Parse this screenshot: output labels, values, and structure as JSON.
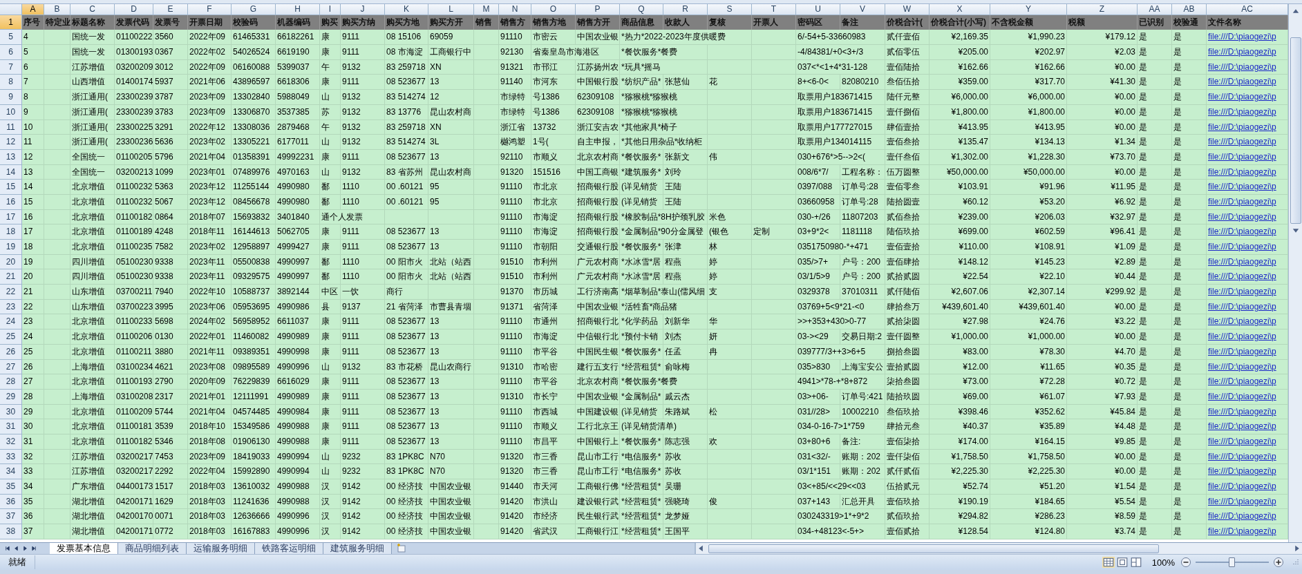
{
  "sheet": {
    "columns": [
      {
        "letter": "A",
        "heading": "序号",
        "selected": true
      },
      {
        "letter": "B",
        "heading": "特定业",
        "selected": false
      },
      {
        "letter": "C",
        "heading": "标题名称",
        "selected": false
      },
      {
        "letter": "D",
        "heading": "发票代码",
        "selected": false
      },
      {
        "letter": "E",
        "heading": "发票号",
        "selected": false
      },
      {
        "letter": "F",
        "heading": "开票日期",
        "selected": false
      },
      {
        "letter": "G",
        "heading": "校验码",
        "selected": false
      },
      {
        "letter": "H",
        "heading": "机器编码",
        "selected": false
      },
      {
        "letter": "I",
        "heading": "购买",
        "selected": false
      },
      {
        "letter": "J",
        "heading": "购买方纳",
        "selected": false
      },
      {
        "letter": "K",
        "heading": "购买方地",
        "selected": false
      },
      {
        "letter": "L",
        "heading": "购买方开",
        "selected": false
      },
      {
        "letter": "M",
        "heading": "销售",
        "selected": false
      },
      {
        "letter": "N",
        "heading": "销售方",
        "selected": false
      },
      {
        "letter": "O",
        "heading": "销售方地",
        "selected": false
      },
      {
        "letter": "P",
        "heading": "销售方开",
        "selected": false
      },
      {
        "letter": "Q",
        "heading": "商品信息",
        "selected": false
      },
      {
        "letter": "R",
        "heading": "收款人",
        "selected": false
      },
      {
        "letter": "S",
        "heading": "复核",
        "selected": false
      },
      {
        "letter": "T",
        "heading": "开票人",
        "selected": false
      },
      {
        "letter": "U",
        "heading": "密码区",
        "selected": false
      },
      {
        "letter": "V",
        "heading": "备注",
        "selected": false
      },
      {
        "letter": "W",
        "heading": "价税合计(",
        "selected": false
      },
      {
        "letter": "X",
        "heading": "价税合计(小写)",
        "selected": false,
        "kind": "currency"
      },
      {
        "letter": "Y",
        "heading": "不含税金额",
        "selected": false,
        "kind": "currency"
      },
      {
        "letter": "Z",
        "heading": "税额",
        "selected": false,
        "kind": "currency"
      },
      {
        "letter": "AA",
        "heading": "已识别",
        "selected": false
      },
      {
        "letter": "AB",
        "heading": "校验通",
        "selected": false
      },
      {
        "letter": "AC",
        "heading": "文件名称",
        "selected": false,
        "kind": "link"
      }
    ],
    "header_row": {
      "number": "1",
      "selected": true
    },
    "rows": [
      {
        "number": "5",
        "selected": false,
        "cells": {
          "A": "4",
          "C": "国统一发",
          "D": "01100222",
          "E": "3560",
          "F": "2022年09",
          "G": "61465331",
          "H": "66182261",
          "I": "康",
          "J": "9111",
          "K": "08 15106",
          "L": "69059",
          "N": "91110",
          "O": "市密云",
          "P": "中国农业银",
          "Q": "*热力*2022-2023年度供暖费",
          "U": "6/-54+5-33660983",
          "W": "贰仟壹佰",
          "X": "¥2,169.35",
          "Y": "¥1,990.23",
          "Z": "¥179.12",
          "AA": "是",
          "AB": "是",
          "AC": "file:///D:\\piaogezi\\p"
        }
      },
      {
        "number": "6",
        "selected": false,
        "cells": {
          "A": "5",
          "C": "国统一发",
          "D": "01300193",
          "E": "0367",
          "F": "2022年02",
          "G": "54026524",
          "H": "6619190",
          "I": "康",
          "J": "9111",
          "K": "08 市海淀",
          "L": "工商银行中",
          "N": "92130",
          "O": "省秦皇岛市海港区",
          "Q": "*餐饮服务*餐费",
          "U": "-4/84381/+0<3+/3",
          "W": "贰佰零伍",
          "X": "¥205.00",
          "Y": "¥202.97",
          "Z": "¥2.03",
          "AA": "是",
          "AB": "是",
          "AC": "file:///D:\\piaogezi\\p"
        }
      },
      {
        "number": "7",
        "selected": false,
        "cells": {
          "A": "6",
          "C": "江苏增值",
          "D": "03200209",
          "E": "3012",
          "F": "2022年09",
          "G": "06160088",
          "H": "5399037",
          "I": "午",
          "J": "9132",
          "K": "83 259718",
          "L": "XN",
          "N": "91321",
          "O": "市邗江",
          "P": "江苏扬州农",
          "Q": "*玩具*摇马",
          "U": "037<*<1+4*31-128",
          "W": "壹佰陆拾",
          "X": "¥162.66",
          "Y": "¥162.66",
          "Z": "¥0.00",
          "AA": "是",
          "AB": "是",
          "AC": "file:///D:\\piaogezi\\p"
        }
      },
      {
        "number": "8",
        "selected": false,
        "cells": {
          "A": "7",
          "C": "山西增值",
          "D": "01400174",
          "E": "5937",
          "F": "2021年06",
          "G": "43896597",
          "H": "6618306",
          "I": "康",
          "J": "9111",
          "K": "08 523677",
          "L": "13",
          "N": "91140",
          "O": "市河东",
          "P": "中国银行股",
          "Q": "*纺织产品*",
          "R": "张慧仙",
          "S": "花",
          "U": "8+<6-0<",
          "V": "82080210",
          "W": "叁佰伍拾",
          "X": "¥359.00",
          "Y": "¥317.70",
          "Z": "¥41.30",
          "AA": "是",
          "AB": "是",
          "AC": "file:///D:\\piaogezi\\p"
        }
      },
      {
        "number": "9",
        "selected": false,
        "cells": {
          "A": "8",
          "C": "浙江通用(",
          "D": "23300239",
          "E": "3787",
          "F": "2023年09",
          "G": "13302840",
          "H": "5988049",
          "I": "山",
          "J": "9132",
          "K": "83 514274",
          "L": "12",
          "N": "市绿特",
          "O": "号1386",
          "P": "62309108",
          "Q": "*猕猴桃*猕猴桃",
          "U": "取票用户183671415",
          "W": "陆仟元整",
          "X": "¥6,000.00",
          "Y": "¥6,000.00",
          "Z": "¥0.00",
          "AA": "是",
          "AB": "是",
          "AC": "file:///D:\\piaogezi\\p"
        }
      },
      {
        "number": "10",
        "selected": false,
        "cells": {
          "A": "9",
          "C": "浙江通用(",
          "D": "23300239",
          "E": "3783",
          "F": "2023年09",
          "G": "13306870",
          "H": "3537385",
          "I": "苏",
          "J": "9132",
          "K": "83 13776",
          "L": "昆山农村商",
          "N": "市绿特",
          "O": "号1386",
          "P": "62309108",
          "Q": "*猕猴桃*猕猴桃",
          "U": "取票用户183671415",
          "W": "壹仟捌佰",
          "X": "¥1,800.00",
          "Y": "¥1,800.00",
          "Z": "¥0.00",
          "AA": "是",
          "AB": "是",
          "AC": "file:///D:\\piaogezi\\p"
        }
      },
      {
        "number": "11",
        "selected": false,
        "cells": {
          "A": "10",
          "C": "浙江通用(",
          "D": "23300225",
          "E": "3291",
          "F": "2022年12",
          "G": "13308036",
          "H": "2879468",
          "I": "午",
          "J": "9132",
          "K": "83 259718",
          "L": "XN",
          "N": "浙江省",
          "O": "13732",
          "P": "浙江安吉农",
          "Q": "*其他家具*椅子",
          "U": "取票用户177727015",
          "W": "肆佰壹拾",
          "X": "¥413.95",
          "Y": "¥413.95",
          "Z": "¥0.00",
          "AA": "是",
          "AB": "是",
          "AC": "file:///D:\\piaogezi\\p"
        }
      },
      {
        "number": "12",
        "selected": false,
        "cells": {
          "A": "11",
          "C": "浙江通用(",
          "D": "23300236",
          "E": "5636",
          "F": "2023年02",
          "G": "13305221",
          "H": "6177011",
          "I": "山",
          "J": "9132",
          "K": "83 514274",
          "L": "3L",
          "N": "樾鸿塑",
          "O": "1号(",
          "P": "自主申报，",
          "Q": "*其他日用杂品*收纳柜",
          "U": "取票用户134014115",
          "W": "壹佰叁拾",
          "X": "¥135.47",
          "Y": "¥134.13",
          "Z": "¥1.34",
          "AA": "是",
          "AB": "是",
          "AC": "file:///D:\\piaogezi\\p"
        }
      },
      {
        "number": "13",
        "selected": false,
        "cells": {
          "A": "12",
          "C": "全国统一",
          "D": "01100205",
          "E": "5796",
          "F": "2021年04",
          "G": "01358391",
          "H": "49992231",
          "I": "康",
          "J": "9111",
          "K": "08 523677",
          "L": "13",
          "N": "92110",
          "O": "市顺义",
          "P": "北京农村商",
          "Q": "*餐饮服务*",
          "R": "张新文",
          "S": "伟",
          "U": "030+676*>5-->2<(",
          "W": "壹仟叁佰",
          "X": "¥1,302.00",
          "Y": "¥1,228.30",
          "Z": "¥73.70",
          "AA": "是",
          "AB": "是",
          "AC": "file:///D:\\piaogezi\\p"
        }
      },
      {
        "number": "14",
        "selected": false,
        "cells": {
          "A": "13",
          "C": "全国统一",
          "D": "03200213",
          "E": "1099",
          "F": "2023年01",
          "G": "07489976",
          "H": "4970163",
          "I": "山",
          "J": "9132",
          "K": "83 省苏州",
          "L": "昆山农村商",
          "N": "91320",
          "O": "151516",
          "P": "中国工商银",
          "Q": "*建筑服务*",
          "R": "刘玲",
          "U": "008/6*7/",
          "V": "工程名称：",
          "W": "伍万圆整",
          "X": "¥50,000.00",
          "Y": "¥50,000.00",
          "Z": "¥0.00",
          "AA": "是",
          "AB": "是",
          "AC": "file:///D:\\piaogezi\\p"
        }
      },
      {
        "number": "15",
        "selected": false,
        "cells": {
          "A": "14",
          "C": "北京增值",
          "D": "01100232",
          "E": "5363",
          "F": "2023年12",
          "G": "11255144",
          "H": "4990980",
          "I": "鄱",
          "J": "1110",
          "K": "00 .60121",
          "L": "95",
          "N": "91110",
          "O": "市北京",
          "P": "招商银行股",
          "Q": "(详见销货",
          "R": "王陆",
          "U": "0397/088",
          "V": "订单号:28",
          "W": "壹佰零叁",
          "X": "¥103.91",
          "Y": "¥91.96",
          "Z": "¥11.95",
          "AA": "是",
          "AB": "是",
          "AC": "file:///D:\\piaogezi\\p"
        }
      },
      {
        "number": "16",
        "selected": false,
        "cells": {
          "A": "15",
          "C": "北京增值",
          "D": "01100232",
          "E": "5067",
          "F": "2023年12",
          "G": "08456678",
          "H": "4990980",
          "I": "鄱",
          "J": "1110",
          "K": "00 .60121",
          "L": "95",
          "N": "91110",
          "O": "市北京",
          "P": "招商银行股",
          "Q": "(详见销货",
          "R": "王陆",
          "U": "03660958",
          "V": "订单号:28",
          "W": "陆拾圆壹",
          "X": "¥60.12",
          "Y": "¥53.20",
          "Z": "¥6.92",
          "AA": "是",
          "AB": "是",
          "AC": "file:///D:\\piaogezi\\p"
        }
      },
      {
        "number": "17",
        "selected": false,
        "cells": {
          "A": "16",
          "C": "北京增值",
          "D": "01100182",
          "E": "0864",
          "F": "2018年07",
          "G": "15693832",
          "H": "3401840",
          "I": "通个人发票",
          "N": "91110",
          "O": "市海淀",
          "P": "招商银行股",
          "Q": "*橡胶制品*8H护颈乳胶",
          "S": "米色",
          "U": "030-+/26",
          "V": "11807203",
          "W": "贰佰叁拾",
          "X": "¥239.00",
          "Y": "¥206.03",
          "Z": "¥32.97",
          "AA": "是",
          "AB": "是",
          "AC": "file:///D:\\piaogezi\\p"
        }
      },
      {
        "number": "18",
        "selected": false,
        "cells": {
          "A": "17",
          "C": "北京增值",
          "D": "01100189",
          "E": "4248",
          "F": "2018年11",
          "G": "16144613",
          "H": "5062705",
          "I": "康",
          "J": "9111",
          "K": "08 523677",
          "L": "13",
          "N": "91110",
          "O": "市海淀",
          "P": "招商银行股",
          "Q": "*金属制品*90分金属登",
          "S": "(银色",
          "T": "定制",
          "U": "03+9*2<",
          "V": "1181118",
          "W": "陆佰玖拾",
          "X": "¥699.00",
          "Y": "¥602.59",
          "Z": "¥96.41",
          "AA": "是",
          "AB": "是",
          "AC": "file:///D:\\piaogezi\\p"
        }
      },
      {
        "number": "19",
        "selected": false,
        "cells": {
          "A": "18",
          "C": "北京增值",
          "D": "01100235",
          "E": "7582",
          "F": "2023年02",
          "G": "12958897",
          "H": "4999427",
          "I": "康",
          "J": "9111",
          "K": "08 523677",
          "L": "13",
          "N": "91110",
          "O": "市朝阳",
          "P": "交通银行股",
          "Q": "*餐饮服务*",
          "R": "张津",
          "S": "林",
          "U": "0351750980-*+471",
          "W": "壹佰壹拾",
          "X": "¥110.00",
          "Y": "¥108.91",
          "Z": "¥1.09",
          "AA": "是",
          "AB": "是",
          "AC": "file:///D:\\piaogezi\\p"
        }
      },
      {
        "number": "20",
        "selected": false,
        "cells": {
          "A": "19",
          "C": "四川增值",
          "D": "05100230",
          "E": "9338",
          "F": "2023年11",
          "G": "05500838",
          "H": "4990997",
          "I": "鄱",
          "J": "1110",
          "K": "00 阳市火",
          "L": "北站（站西",
          "N": "91510",
          "O": "市利州",
          "P": "广元农村商",
          "Q": "*水冰雪*居",
          "R": "程燕",
          "S": "婷",
          "U": "035/>7+",
          "V": "户号：200",
          "W": "壹佰肆拾",
          "X": "¥148.12",
          "Y": "¥145.23",
          "Z": "¥2.89",
          "AA": "是",
          "AB": "是",
          "AC": "file:///D:\\piaogezi\\p"
        }
      },
      {
        "number": "21",
        "selected": false,
        "cells": {
          "A": "20",
          "C": "四川增值",
          "D": "05100230",
          "E": "9338",
          "F": "2023年11",
          "G": "09329575",
          "H": "4990997",
          "I": "鄱",
          "J": "1110",
          "K": "00 阳市火",
          "L": "北站（站西",
          "N": "91510",
          "O": "市利州",
          "P": "广元农村商",
          "Q": "*水冰雪*居",
          "R": "程燕",
          "S": "婷",
          "U": "03/1/5>9",
          "V": "户号：200",
          "W": "贰拾贰圆",
          "X": "¥22.54",
          "Y": "¥22.10",
          "Z": "¥0.44",
          "AA": "是",
          "AB": "是",
          "AC": "file:///D:\\piaogezi\\p"
        }
      },
      {
        "number": "22",
        "selected": false,
        "cells": {
          "A": "21",
          "C": "山东增值",
          "D": "03700211",
          "E": "7940",
          "F": "2022年10",
          "G": "10588737",
          "H": "3892144",
          "I": "中区",
          "J": "一饮",
          "K": "商行",
          "N": "91370",
          "O": "市历城",
          "P": "工行济南高",
          "Q": "*烟草制品*泰山(儒风细",
          "S": "支",
          "U": "0329378",
          "V": "37010311",
          "W": "贰仟陆佰",
          "X": "¥2,607.06",
          "Y": "¥2,307.14",
          "Z": "¥299.92",
          "AA": "是",
          "AB": "是",
          "AC": "file:///D:\\piaogezi\\p"
        }
      },
      {
        "number": "23",
        "selected": false,
        "cells": {
          "A": "22",
          "C": "山东增值",
          "D": "03700223",
          "E": "3995",
          "F": "2023年06",
          "G": "05953695",
          "H": "4990986",
          "I": "县",
          "J": "9137",
          "K": "21 省菏泽",
          "L": "市曹县青堌",
          "N": "91371",
          "O": "省菏泽",
          "P": "中国农业银",
          "Q": "*活牲畜*商品猪",
          "U": "03769+5<9*21-<0",
          "W": "肆拾叁万",
          "X": "¥439,601.40",
          "Y": "¥439,601.40",
          "Z": "¥0.00",
          "AA": "是",
          "AB": "是",
          "AC": "file:///D:\\piaogezi\\p"
        }
      },
      {
        "number": "24",
        "selected": false,
        "cells": {
          "A": "23",
          "C": "北京增值",
          "D": "01100233",
          "E": "5698",
          "F": "2024年02",
          "G": "56958952",
          "H": "6611037",
          "I": "康",
          "J": "9111",
          "K": "08 523677",
          "L": "13",
          "N": "91110",
          "O": "市通州",
          "P": "招商银行北",
          "Q": "*化学药品",
          "R": "刘新华",
          "S": "华",
          "U": ">>+353+430>0-77",
          "W": "贰拾柒圆",
          "X": "¥27.98",
          "Y": "¥24.76",
          "Z": "¥3.22",
          "AA": "是",
          "AB": "是",
          "AC": "file:///D:\\piaogezi\\p"
        }
      },
      {
        "number": "25",
        "selected": false,
        "cells": {
          "A": "24",
          "C": "北京增值",
          "D": "01100206",
          "E": "0130",
          "F": "2022年01",
          "G": "11460082",
          "H": "4990989",
          "I": "康",
          "J": "9111",
          "K": "08 523677",
          "L": "13",
          "N": "91110",
          "O": "市海淀",
          "P": "中信银行北",
          "Q": "*预付卡销",
          "R": "刘杰",
          "S": "妍",
          "U": "03-><29",
          "V": "交易日期:2",
          "W": "壹仟圆整",
          "X": "¥1,000.00",
          "Y": "¥1,000.00",
          "Z": "¥0.00",
          "AA": "是",
          "AB": "是",
          "AC": "file:///D:\\piaogezi\\p"
        }
      },
      {
        "number": "26",
        "selected": false,
        "cells": {
          "A": "25",
          "C": "北京增值",
          "D": "01100211",
          "E": "3880",
          "F": "2021年11",
          "G": "09389351",
          "H": "4990998",
          "I": "康",
          "J": "9111",
          "K": "08 523677",
          "L": "13",
          "N": "91110",
          "O": "市平谷",
          "P": "中国民生银",
          "Q": "*餐饮服务*",
          "R": "任孟",
          "S": "冉",
          "U": "039777/3++3>6+5",
          "W": "捌拾叁圆",
          "X": "¥83.00",
          "Y": "¥78.30",
          "Z": "¥4.70",
          "AA": "是",
          "AB": "是",
          "AC": "file:///D:\\piaogezi\\p"
        }
      },
      {
        "number": "27",
        "selected": false,
        "cells": {
          "A": "26",
          "C": "上海增值",
          "D": "03100234",
          "E": "4621",
          "F": "2023年08",
          "G": "09895589",
          "H": "4990996",
          "I": "山",
          "J": "9132",
          "K": "83 市花桥",
          "L": "昆山农商行",
          "N": "91310",
          "O": "市哈密",
          "P": "建行五支行",
          "Q": "*经营租赁*",
          "R": "俞咏梅",
          "U": "035>830",
          "V": "上海宝安公",
          "W": "壹拾贰圆",
          "X": "¥12.00",
          "Y": "¥11.65",
          "Z": "¥0.35",
          "AA": "是",
          "AB": "是",
          "AC": "file:///D:\\piaogezi\\p"
        }
      },
      {
        "number": "28",
        "selected": false,
        "cells": {
          "A": "27",
          "C": "北京增值",
          "D": "01100193",
          "E": "2790",
          "F": "2020年09",
          "G": "76229839",
          "H": "6616029",
          "I": "康",
          "J": "9111",
          "K": "08 523677",
          "L": "13",
          "N": "91110",
          "O": "市平谷",
          "P": "北京农村商",
          "Q": "*餐饮服务*餐费",
          "U": "4941>*78-+*8+872",
          "W": "柒拾叁圆",
          "X": "¥73.00",
          "Y": "¥72.28",
          "Z": "¥0.72",
          "AA": "是",
          "AB": "是",
          "AC": "file:///D:\\piaogezi\\p"
        }
      },
      {
        "number": "29",
        "selected": false,
        "cells": {
          "A": "28",
          "C": "上海增值",
          "D": "03100208",
          "E": "2317",
          "F": "2021年01",
          "G": "12111991",
          "H": "4990989",
          "I": "康",
          "J": "9111",
          "K": "08 523677",
          "L": "13",
          "N": "91310",
          "O": "市长宁",
          "P": "中国农业银",
          "Q": "*金属制品*",
          "R": "戚云杰",
          "U": "03>+06-",
          "V": "订单号:421",
          "W": "陆拾玖圆",
          "X": "¥69.00",
          "Y": "¥61.07",
          "Z": "¥7.93",
          "AA": "是",
          "AB": "是",
          "AC": "file:///D:\\piaogezi\\p"
        }
      },
      {
        "number": "30",
        "selected": false,
        "cells": {
          "A": "29",
          "C": "北京增值",
          "D": "01100209",
          "E": "5744",
          "F": "2021年04",
          "G": "04574485",
          "H": "4990984",
          "I": "康",
          "J": "9111",
          "K": "08 523677",
          "L": "13",
          "N": "91110",
          "O": "市西城",
          "P": "中国建设银",
          "Q": "(详见销货",
          "R": "朱路斌",
          "S": "松",
          "U": "031//28>",
          "V": "10002210",
          "W": "叁佰玖拾",
          "X": "¥398.46",
          "Y": "¥352.62",
          "Z": "¥45.84",
          "AA": "是",
          "AB": "是",
          "AC": "file:///D:\\piaogezi\\p"
        }
      },
      {
        "number": "31",
        "selected": false,
        "cells": {
          "A": "30",
          "C": "北京增值",
          "D": "01100181",
          "E": "3539",
          "F": "2018年10",
          "G": "15349586",
          "H": "4990988",
          "I": "康",
          "J": "9111",
          "K": "08 523677",
          "L": "13",
          "N": "91110",
          "O": "市顺义",
          "P": "工行北京王",
          "Q": "(详见销货清单)",
          "U": "034-0-16-7>1*759",
          "W": "肆拾元叁",
          "X": "¥40.37",
          "Y": "¥35.89",
          "Z": "¥4.48",
          "AA": "是",
          "AB": "是",
          "AC": "file:///D:\\piaogezi\\p"
        }
      },
      {
        "number": "32",
        "selected": false,
        "cells": {
          "A": "31",
          "C": "北京增值",
          "D": "01100182",
          "E": "5346",
          "F": "2018年08",
          "G": "01906130",
          "H": "4990988",
          "I": "康",
          "J": "9111",
          "K": "08 523677",
          "L": "13",
          "N": "91110",
          "O": "市昌平",
          "P": "中国银行上",
          "Q": "*餐饮服务*",
          "R": "陈志强",
          "S": "欢",
          "U": "03+80+6",
          "V": "备注:",
          "W": "壹佰柒拾",
          "X": "¥174.00",
          "Y": "¥164.15",
          "Z": "¥9.85",
          "AA": "是",
          "AB": "是",
          "AC": "file:///D:\\piaogezi\\p"
        }
      },
      {
        "number": "33",
        "selected": false,
        "cells": {
          "A": "32",
          "C": "江苏增值",
          "D": "03200217",
          "E": "7453",
          "F": "2023年09",
          "G": "18419033",
          "H": "4990994",
          "I": "山",
          "J": "9232",
          "K": "83 1PK8C",
          "L": "N70",
          "N": "91320",
          "O": "市三香",
          "P": "昆山市工行",
          "Q": "*电信服务*",
          "R": "苏收",
          "U": "031<32/-",
          "V": "账期：202",
          "W": "壹仟柒佰",
          "X": "¥1,758.50",
          "Y": "¥1,758.50",
          "Z": "¥0.00",
          "AA": "是",
          "AB": "是",
          "AC": "file:///D:\\piaogezi\\p"
        }
      },
      {
        "number": "34",
        "selected": false,
        "cells": {
          "A": "33",
          "C": "江苏增值",
          "D": "03200217",
          "E": "2292",
          "F": "2022年04",
          "G": "15992890",
          "H": "4990994",
          "I": "山",
          "J": "9232",
          "K": "83 1PK8C",
          "L": "N70",
          "N": "91320",
          "O": "市三香",
          "P": "昆山市工行",
          "Q": "*电信服务*",
          "R": "苏收",
          "U": "03/1*151",
          "V": "账期：202",
          "W": "贰仟贰佰",
          "X": "¥2,225.30",
          "Y": "¥2,225.30",
          "Z": "¥0.00",
          "AA": "是",
          "AB": "是",
          "AC": "file:///D:\\piaogezi\\p"
        }
      },
      {
        "number": "35",
        "selected": false,
        "cells": {
          "A": "34",
          "C": "广东增值",
          "D": "04400173",
          "E": "1517",
          "F": "2018年03",
          "G": "13610032",
          "H": "4990988",
          "I": "汉",
          "J": "9142",
          "K": "00 经济技",
          "L": "中国农业银",
          "N": "91440",
          "O": "市天河",
          "P": "工商银行佛",
          "Q": "*经营租赁*",
          "R": "吴珊",
          "U": "03<+85/<<29<<03",
          "W": "伍拾贰元",
          "X": "¥52.74",
          "Y": "¥51.20",
          "Z": "¥1.54",
          "AA": "是",
          "AB": "是",
          "AC": "file:///D:\\piaogezi\\p"
        }
      },
      {
        "number": "36",
        "selected": false,
        "cells": {
          "A": "35",
          "C": "湖北增值",
          "D": "04200171",
          "E": "1629",
          "F": "2018年03",
          "G": "11241636",
          "H": "4990988",
          "I": "汉",
          "J": "9142",
          "K": "00 经济技",
          "L": "中国农业银",
          "N": "91420",
          "O": "市洪山",
          "P": "建设银行武",
          "Q": "*经营租赁*",
          "R": "强晓琦",
          "S": "俊",
          "U": "037+143",
          "V": "汇总开具",
          "W": "壹佰玖拾",
          "X": "¥190.19",
          "Y": "¥184.65",
          "Z": "¥5.54",
          "AA": "是",
          "AB": "是",
          "AC": "file:///D:\\piaogezi\\p"
        }
      },
      {
        "number": "37",
        "selected": false,
        "cells": {
          "A": "36",
          "C": "湖北增值",
          "D": "04200170",
          "E": "0071",
          "F": "2018年03",
          "G": "12636666",
          "H": "4990996",
          "I": "汉",
          "J": "9142",
          "K": "00 经济技",
          "L": "中国农业银",
          "N": "91420",
          "O": "市经济",
          "P": "民生银行武",
          "Q": "*经营租赁*",
          "R": "龙梦娅",
          "U": "030243319>1*+9*2",
          "W": "贰佰玖拾",
          "X": "¥294.82",
          "Y": "¥286.23",
          "Z": "¥8.59",
          "AA": "是",
          "AB": "是",
          "AC": "file:///D:\\piaogezi\\p"
        }
      },
      {
        "number": "38",
        "selected": false,
        "cells": {
          "A": "37",
          "C": "湖北增值",
          "D": "04200171",
          "E": "0772",
          "F": "2018年03",
          "G": "16167883",
          "H": "4990996",
          "I": "汉",
          "J": "9142",
          "K": "00 经济技",
          "L": "中国农业银",
          "N": "91420",
          "O": "省武汉",
          "P": "工商银行江",
          "Q": "*经营租赁*",
          "R": "王国平",
          "U": "034-+48123<-5+>",
          "W": "壹佰贰拾",
          "X": "¥128.54",
          "Y": "¥124.80",
          "Z": "¥3.74",
          "AA": "是",
          "AB": "是",
          "AC": "file:///D:\\piaogezi\\p"
        }
      }
    ]
  },
  "sheet_tabs": [
    {
      "label": "发票基本信息",
      "selected": true
    },
    {
      "label": "商品明细列表",
      "selected": false
    },
    {
      "label": "运输服务明细",
      "selected": false
    },
    {
      "label": "铁路客运明细",
      "selected": false
    },
    {
      "label": "建筑服务明细",
      "selected": false
    }
  ],
  "status_bar": {
    "status": "就绪",
    "zoom": "100%",
    "zoom_slider": {
      "level": 0.5
    }
  }
}
